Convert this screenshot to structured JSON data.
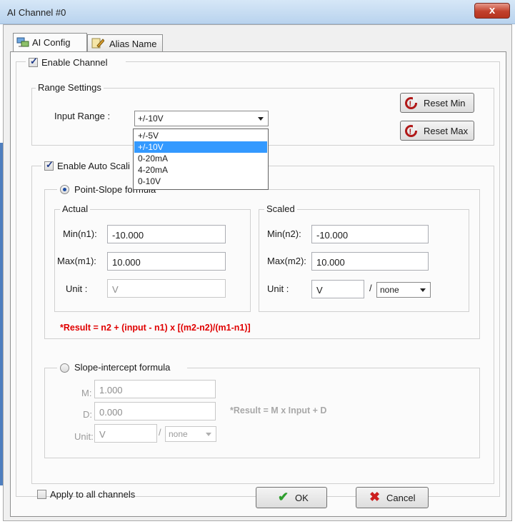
{
  "window": {
    "title": "AI Channel #0",
    "close_glyph": "x"
  },
  "tabs": [
    {
      "label": "AI Config",
      "icon": "network-icon",
      "active": true
    },
    {
      "label": "Alias Name",
      "icon": "pencil-icon",
      "active": false
    }
  ],
  "enable_channel": {
    "label": "Enable Channel",
    "checked": true
  },
  "range_settings": {
    "legend": "Range Settings",
    "input_range_label": "Input Range :",
    "selected": "+/-10V",
    "options": [
      "+/-5V",
      "+/-10V",
      "0-20mA",
      "4-20mA",
      "0-10V"
    ],
    "reset_min": "Reset Min",
    "reset_max": "Reset Max"
  },
  "auto_scaling": {
    "label": "Enable Auto Scali",
    "checked": true,
    "point_slope": {
      "label": "Point-Slope formula",
      "selected": true,
      "actual": {
        "legend": "Actual",
        "min_label": "Min(n1):",
        "min_value": "-10.000",
        "max_label": "Max(m1):",
        "max_value": "10.000",
        "unit_label": "Unit :",
        "unit_value": "V"
      },
      "scaled": {
        "legend": "Scaled",
        "min_label": "Min(n2):",
        "min_value": "-10.000",
        "max_label": "Max(m2):",
        "max_value": "10.000",
        "unit_label": "Unit :",
        "unit_value": "V",
        "per_label": "/",
        "per_select": "none"
      },
      "result": "*Result = n2 + (input - n1) x [(m2-n2)/(m1-n1)]"
    },
    "slope_intercept": {
      "label": "Slope-intercept formula",
      "selected": false,
      "m_label": "M:",
      "m_value": "1.000",
      "d_label": "D:",
      "d_value": "0.000",
      "unit_label": "Unit:",
      "unit_value": "V",
      "per_label": "/",
      "per_select": "none",
      "result": "*Result = M x Input + D"
    }
  },
  "apply_all": {
    "label": "Apply to all channels",
    "checked": false
  },
  "buttons": {
    "ok": "OK",
    "cancel": "Cancel"
  },
  "colors": {
    "formula_red": "#e00000",
    "selection_blue": "#3399ff",
    "ok_green": "#2e9e2e",
    "cancel_red": "#cc1e1e"
  }
}
